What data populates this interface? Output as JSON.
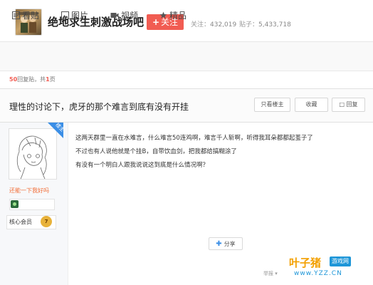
{
  "forum": {
    "name": "绝地求生刺激战场吧",
    "follow_label": "关注",
    "followers_label": "关注：",
    "followers": "432,019",
    "posts_label": "贴子：",
    "posts": "5,433,718"
  },
  "tabs": [
    {
      "label": "看贴",
      "icon": "posts-icon"
    },
    {
      "label": "图片",
      "icon": "image-icon"
    },
    {
      "label": "视频",
      "icon": "video-icon"
    },
    {
      "label": "精品",
      "icon": "star-icon"
    }
  ],
  "reply_info": {
    "count": "50",
    "count_suffix": "回复贴，共",
    "pages": "1",
    "pages_suffix": "页"
  },
  "thread": {
    "title": "理性的讨论下，虎牙的那个难言到底有没有开挂",
    "buttons": [
      "只看楼主",
      "收藏",
      "回复"
    ]
  },
  "post": {
    "badge": "楼主",
    "author": "还能一下我好吗",
    "member_label": "核心会员",
    "member_level": "7",
    "lines": [
      "这两天群里一直在水难言，什么难言50连鸡啊，难言千人斩啊，听得我耳朵都都起茧子了",
      "不过也有人说他就是个挂B，自带饮血剑，把我都给搞糊涂了",
      "有没有一个明白人跟我说说这到底是什么情况啊？"
    ],
    "share_label": "分享",
    "report_label": "举报"
  },
  "watermark": {
    "name": "叶子猪",
    "tag": "游戏网",
    "url": "www.YZZ.CN"
  },
  "colors": {
    "accent_red": "#f15c52",
    "author_orange": "#f26f3a",
    "badge_blue": "#3a8ee6",
    "watermark_orange": "#f3a000",
    "watermark_blue": "#1e96d8"
  }
}
